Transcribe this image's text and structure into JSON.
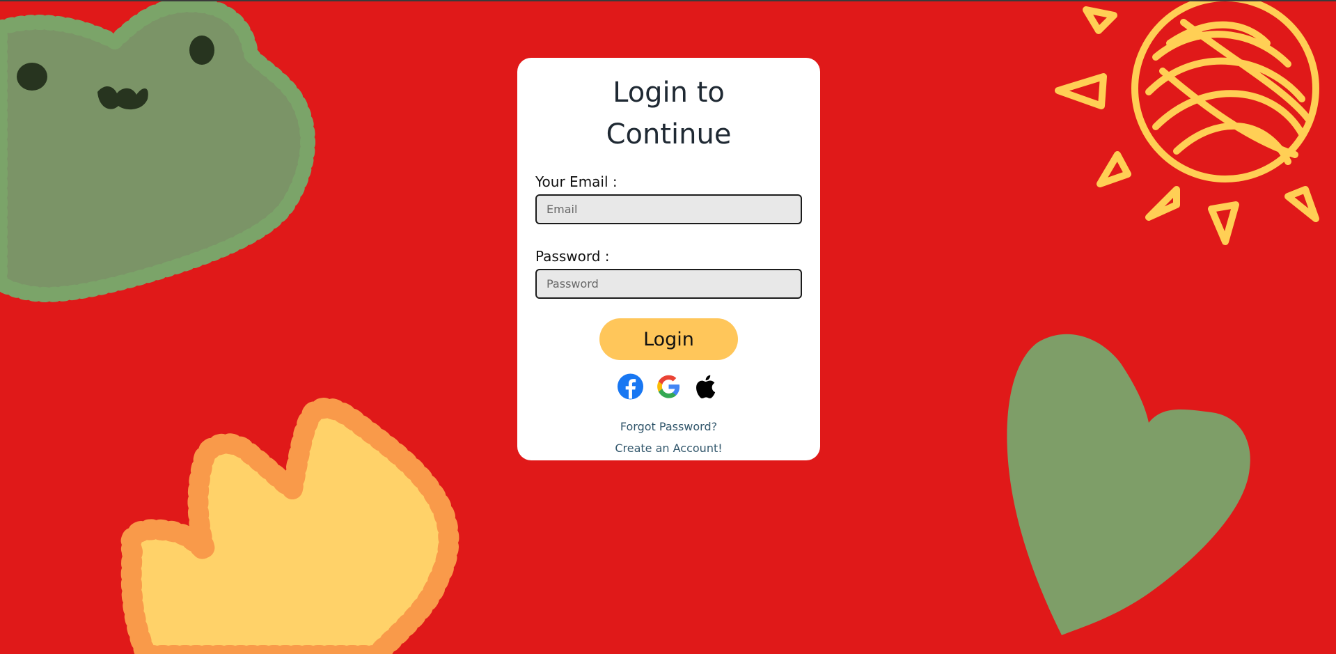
{
  "theme": {
    "background": "#e01919",
    "accent": "#ffc65a",
    "frog_color": "#7b9467",
    "frog_outline": "#7ba469",
    "frog_features": "#27341f",
    "crown_fill": "#ffd269",
    "crown_outline": "#f99a4a",
    "sun_color": "#ffcf55",
    "heart_color": "#7e9e68",
    "link_color": "#31566b"
  },
  "login": {
    "title_line1": "Login to",
    "title_line2": "Continue",
    "email_label": "Your Email :",
    "email_placeholder": "Email",
    "email_value": "",
    "password_label": "Password :",
    "password_placeholder": "Password",
    "password_value": "",
    "submit_label": "Login",
    "social": [
      {
        "name": "facebook",
        "icon": "facebook-icon"
      },
      {
        "name": "google",
        "icon": "google-icon"
      },
      {
        "name": "apple",
        "icon": "apple-icon"
      }
    ],
    "forgot_link": "Forgot Password?",
    "create_link": "Create an Account!"
  },
  "decorations": [
    "frog-doodle",
    "crown-doodle",
    "sun-doodle",
    "heart-doodle"
  ]
}
